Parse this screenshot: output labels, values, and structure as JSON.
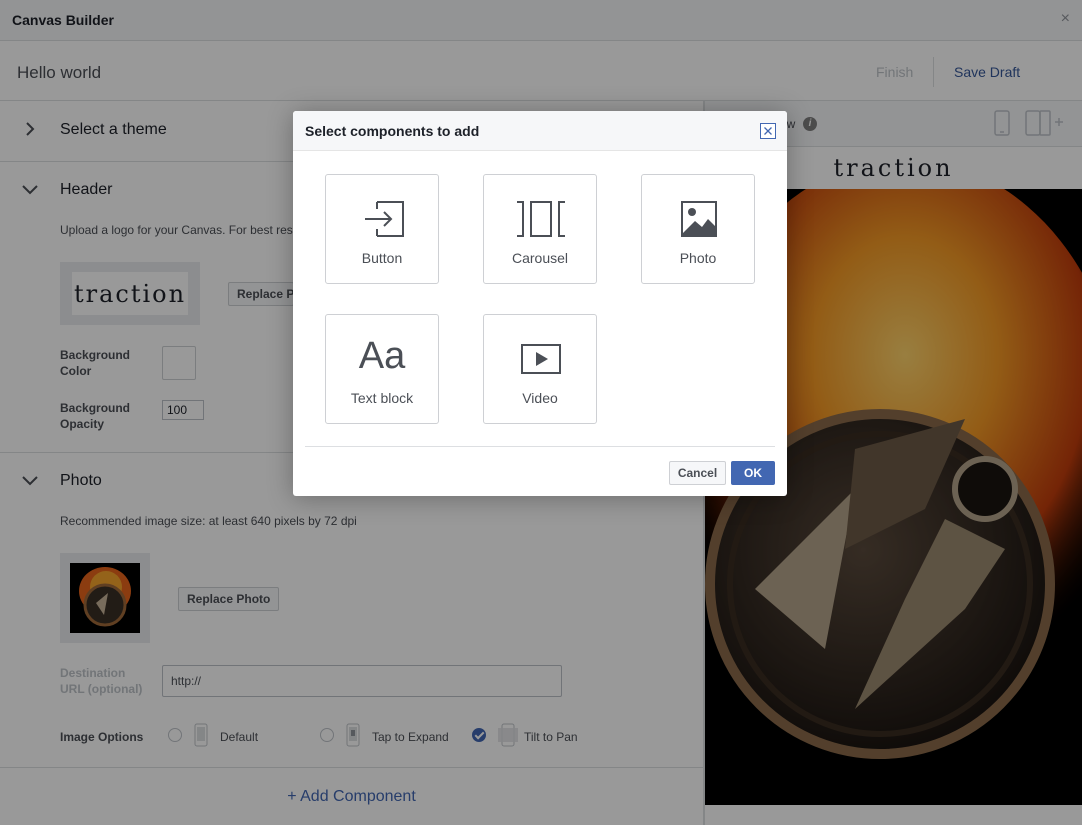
{
  "window": {
    "title": "Canvas Builder",
    "close_glyph": "×"
  },
  "toolbar": {
    "canvas_name": "Hello world",
    "finish_label": "Finish",
    "save_draft_label": "Save Draft"
  },
  "sections": {
    "theme": {
      "label": "Select a theme"
    },
    "header": {
      "label": "Header",
      "hint": "Upload a logo for your Canvas. For best res",
      "logo_text": "traction",
      "replace_button": "Replace P",
      "bg_color_label_1": "Background",
      "bg_color_label_2": "Color",
      "bg_opacity_label_1": "Background",
      "bg_opacity_label_2": "Opacity",
      "bg_opacity_value": "100"
    },
    "photo": {
      "label": "Photo",
      "hint": "Recommended image size: at least 640 pixels by 72 dpi",
      "replace_button": "Replace Photo",
      "dest_label_1": "Destination",
      "dest_label_2": "URL (optional)",
      "dest_value": "http://",
      "image_options_label": "Image Options",
      "options": [
        {
          "label": "Default",
          "checked": false
        },
        {
          "label": "Tap to Expand",
          "checked": false
        },
        {
          "label": "Tilt to Pan",
          "checked": true
        }
      ]
    }
  },
  "add_component_label": "+ Add Component",
  "preview": {
    "label_partial": "ew",
    "info_glyph": "i",
    "logo_text": "traction"
  },
  "modal": {
    "title": "Select components to add",
    "components": [
      {
        "label": "Button",
        "icon": "button-icon"
      },
      {
        "label": "Carousel",
        "icon": "carousel-icon"
      },
      {
        "label": "Photo",
        "icon": "photo-icon"
      },
      {
        "label": "Text block",
        "icon": "text-block-icon",
        "glyph": "Aa"
      },
      {
        "label": "Video",
        "icon": "video-icon"
      }
    ],
    "cancel_label": "Cancel",
    "ok_label": "OK"
  },
  "colors": {
    "accent": "#4267b2",
    "link": "#365899",
    "overlay": "rgba(0,0,0,0.4)"
  }
}
